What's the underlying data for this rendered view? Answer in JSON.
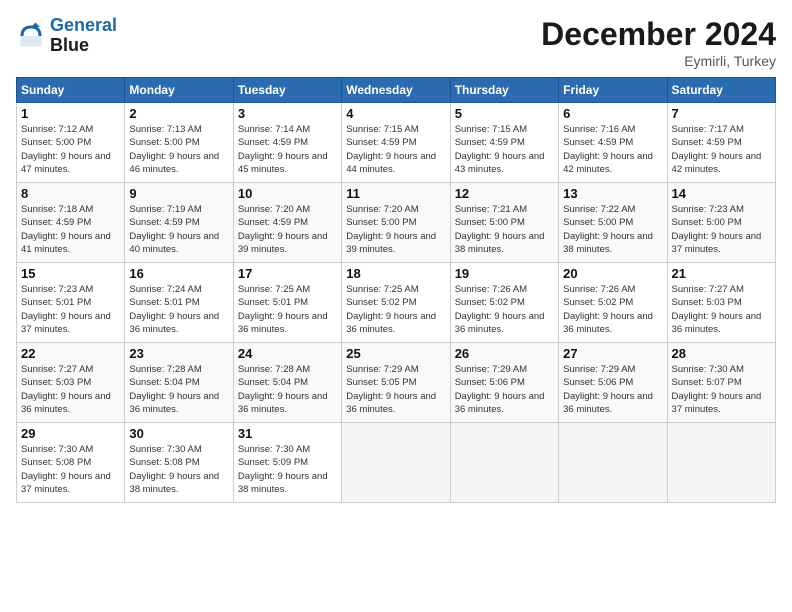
{
  "header": {
    "logo_line1": "General",
    "logo_line2": "Blue",
    "month": "December 2024",
    "location": "Eymirli, Turkey"
  },
  "weekdays": [
    "Sunday",
    "Monday",
    "Tuesday",
    "Wednesday",
    "Thursday",
    "Friday",
    "Saturday"
  ],
  "weeks": [
    [
      {
        "day": "1",
        "info": "Sunrise: 7:12 AM\nSunset: 5:00 PM\nDaylight: 9 hours and 47 minutes."
      },
      {
        "day": "2",
        "info": "Sunrise: 7:13 AM\nSunset: 5:00 PM\nDaylight: 9 hours and 46 minutes."
      },
      {
        "day": "3",
        "info": "Sunrise: 7:14 AM\nSunset: 4:59 PM\nDaylight: 9 hours and 45 minutes."
      },
      {
        "day": "4",
        "info": "Sunrise: 7:15 AM\nSunset: 4:59 PM\nDaylight: 9 hours and 44 minutes."
      },
      {
        "day": "5",
        "info": "Sunrise: 7:15 AM\nSunset: 4:59 PM\nDaylight: 9 hours and 43 minutes."
      },
      {
        "day": "6",
        "info": "Sunrise: 7:16 AM\nSunset: 4:59 PM\nDaylight: 9 hours and 42 minutes."
      },
      {
        "day": "7",
        "info": "Sunrise: 7:17 AM\nSunset: 4:59 PM\nDaylight: 9 hours and 42 minutes."
      }
    ],
    [
      {
        "day": "8",
        "info": "Sunrise: 7:18 AM\nSunset: 4:59 PM\nDaylight: 9 hours and 41 minutes."
      },
      {
        "day": "9",
        "info": "Sunrise: 7:19 AM\nSunset: 4:59 PM\nDaylight: 9 hours and 40 minutes."
      },
      {
        "day": "10",
        "info": "Sunrise: 7:20 AM\nSunset: 4:59 PM\nDaylight: 9 hours and 39 minutes."
      },
      {
        "day": "11",
        "info": "Sunrise: 7:20 AM\nSunset: 5:00 PM\nDaylight: 9 hours and 39 minutes."
      },
      {
        "day": "12",
        "info": "Sunrise: 7:21 AM\nSunset: 5:00 PM\nDaylight: 9 hours and 38 minutes."
      },
      {
        "day": "13",
        "info": "Sunrise: 7:22 AM\nSunset: 5:00 PM\nDaylight: 9 hours and 38 minutes."
      },
      {
        "day": "14",
        "info": "Sunrise: 7:23 AM\nSunset: 5:00 PM\nDaylight: 9 hours and 37 minutes."
      }
    ],
    [
      {
        "day": "15",
        "info": "Sunrise: 7:23 AM\nSunset: 5:01 PM\nDaylight: 9 hours and 37 minutes."
      },
      {
        "day": "16",
        "info": "Sunrise: 7:24 AM\nSunset: 5:01 PM\nDaylight: 9 hours and 36 minutes."
      },
      {
        "day": "17",
        "info": "Sunrise: 7:25 AM\nSunset: 5:01 PM\nDaylight: 9 hours and 36 minutes."
      },
      {
        "day": "18",
        "info": "Sunrise: 7:25 AM\nSunset: 5:02 PM\nDaylight: 9 hours and 36 minutes."
      },
      {
        "day": "19",
        "info": "Sunrise: 7:26 AM\nSunset: 5:02 PM\nDaylight: 9 hours and 36 minutes."
      },
      {
        "day": "20",
        "info": "Sunrise: 7:26 AM\nSunset: 5:02 PM\nDaylight: 9 hours and 36 minutes."
      },
      {
        "day": "21",
        "info": "Sunrise: 7:27 AM\nSunset: 5:03 PM\nDaylight: 9 hours and 36 minutes."
      }
    ],
    [
      {
        "day": "22",
        "info": "Sunrise: 7:27 AM\nSunset: 5:03 PM\nDaylight: 9 hours and 36 minutes."
      },
      {
        "day": "23",
        "info": "Sunrise: 7:28 AM\nSunset: 5:04 PM\nDaylight: 9 hours and 36 minutes."
      },
      {
        "day": "24",
        "info": "Sunrise: 7:28 AM\nSunset: 5:04 PM\nDaylight: 9 hours and 36 minutes."
      },
      {
        "day": "25",
        "info": "Sunrise: 7:29 AM\nSunset: 5:05 PM\nDaylight: 9 hours and 36 minutes."
      },
      {
        "day": "26",
        "info": "Sunrise: 7:29 AM\nSunset: 5:06 PM\nDaylight: 9 hours and 36 minutes."
      },
      {
        "day": "27",
        "info": "Sunrise: 7:29 AM\nSunset: 5:06 PM\nDaylight: 9 hours and 36 minutes."
      },
      {
        "day": "28",
        "info": "Sunrise: 7:30 AM\nSunset: 5:07 PM\nDaylight: 9 hours and 37 minutes."
      }
    ],
    [
      {
        "day": "29",
        "info": "Sunrise: 7:30 AM\nSunset: 5:08 PM\nDaylight: 9 hours and 37 minutes."
      },
      {
        "day": "30",
        "info": "Sunrise: 7:30 AM\nSunset: 5:08 PM\nDaylight: 9 hours and 38 minutes."
      },
      {
        "day": "31",
        "info": "Sunrise: 7:30 AM\nSunset: 5:09 PM\nDaylight: 9 hours and 38 minutes."
      },
      null,
      null,
      null,
      null
    ]
  ]
}
